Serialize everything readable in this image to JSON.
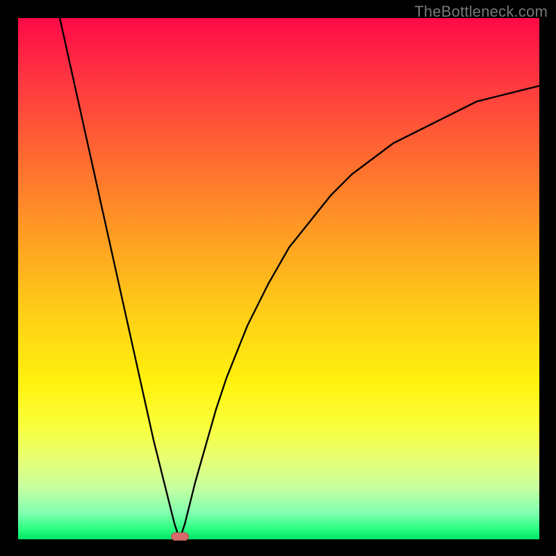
{
  "watermark": "TheBottleneck.com",
  "chart_data": {
    "type": "line",
    "title": "",
    "xlabel": "",
    "ylabel": "",
    "xlim": [
      0,
      100
    ],
    "ylim": [
      0,
      100
    ],
    "grid": false,
    "series": [
      {
        "name": "curve",
        "x": [
          8,
          10,
          12,
          14,
          16,
          18,
          20,
          22,
          24,
          26,
          27,
          28,
          29,
          30,
          31,
          32,
          33,
          34,
          36,
          38,
          40,
          44,
          48,
          52,
          56,
          60,
          64,
          68,
          72,
          76,
          80,
          84,
          88,
          92,
          96,
          100
        ],
        "y": [
          100,
          91,
          82,
          73,
          64,
          55,
          46,
          37,
          28,
          19,
          15,
          11,
          7,
          3,
          0,
          3,
          7,
          11,
          18,
          25,
          31,
          41,
          49,
          56,
          61,
          66,
          70,
          73,
          76,
          78,
          80,
          82,
          84,
          85,
          86,
          87
        ]
      }
    ],
    "marker": {
      "x": 31,
      "y": 0,
      "color": "#d66b6b"
    },
    "background_gradient": {
      "top": "#ff0a46",
      "middle": "#ffd215",
      "bottom": "#00e46a"
    }
  }
}
